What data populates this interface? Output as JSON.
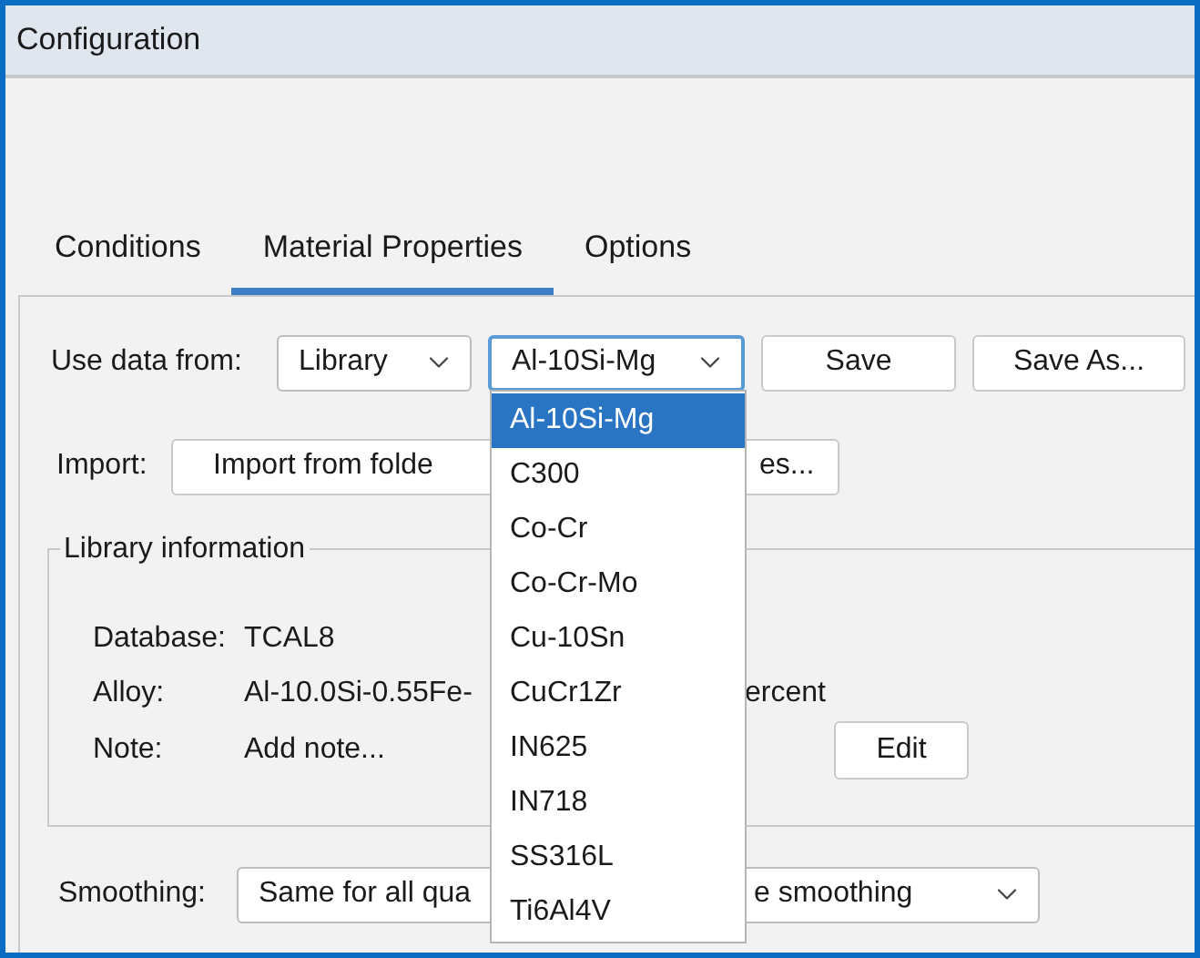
{
  "window": {
    "title": "Configuration"
  },
  "tabs": [
    {
      "label": "Conditions",
      "selected": false
    },
    {
      "label": "Material Properties",
      "selected": true
    },
    {
      "label": "Options",
      "selected": false
    }
  ],
  "use_data_from": {
    "label": "Use data from:",
    "source": "Library",
    "material": "Al-10Si-Mg",
    "buttons": [
      "Save",
      "Save As..."
    ]
  },
  "material_menu": {
    "items": [
      {
        "label": "Al-10Si-Mg",
        "selected": true
      },
      {
        "label": "C300",
        "selected": false
      },
      {
        "label": "Co-Cr",
        "selected": false
      },
      {
        "label": "Co-Cr-Mo",
        "selected": false
      },
      {
        "label": "Cu-10Sn",
        "selected": false
      },
      {
        "label": "CuCr1Zr",
        "selected": false
      },
      {
        "label": "IN625",
        "selected": false
      },
      {
        "label": "IN718",
        "selected": false
      },
      {
        "label": "SS316L",
        "selected": false
      },
      {
        "label": "Ti6Al4V",
        "selected": false
      }
    ]
  },
  "import": {
    "label": "Import:",
    "button_parts": [
      "Import from folde",
      "es..."
    ]
  },
  "library_information": {
    "title": "Library information",
    "database_label": "Database:",
    "database": "TCAL8",
    "alloy_label": "Alloy:",
    "alloy_parts": [
      "Al-10.0Si-0.55Fe-",
      "ercent"
    ],
    "note_label": "Note:",
    "note": "Add note...",
    "edit_button": "Edit"
  },
  "smoothing": {
    "label": "Smoothing:",
    "value_parts": [
      "Same for all qua",
      "e smoothing"
    ]
  }
}
